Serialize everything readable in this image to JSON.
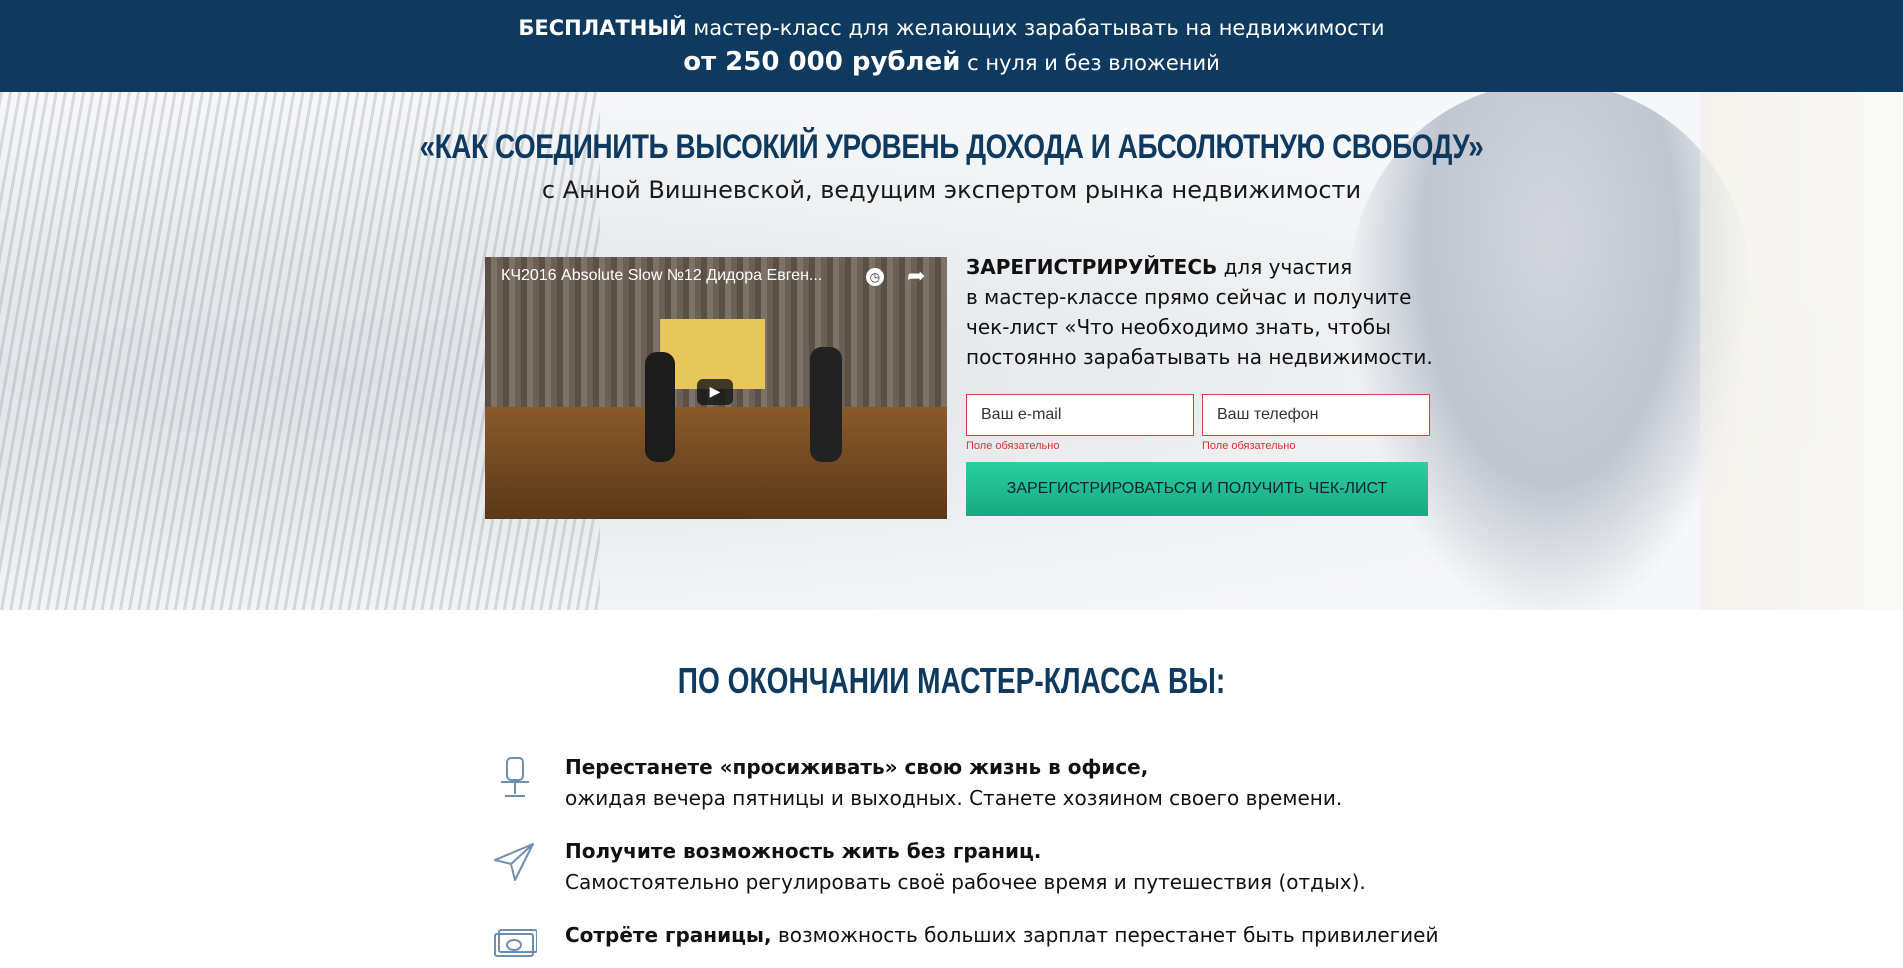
{
  "topbar": {
    "line1_bold": "БЕСПЛАТНЫЙ",
    "line1_rest": " мастер-класс для желающих зарабатывать на недвижимости",
    "line2_bold": "от 250 000 рублей",
    "line2_rest": " с нуля и без вложений"
  },
  "hero": {
    "title": "«КАК СОЕДИНИТЬ ВЫСОКИЙ УРОВЕНЬ ДОХОДА И АБСОЛЮТНУЮ СВОБОДУ»",
    "subtitle": "с Анной Вишневской, ведущим экспертом рынка недвижимости"
  },
  "video": {
    "title": "КЧ2016 Absolute Slow №12 Дидора Евген...",
    "clock_icon": "clock-icon",
    "share_icon": "share-icon",
    "play_icon": "play-icon"
  },
  "registration": {
    "lead_bold": "ЗАРЕГИСТРИРУЙТЕСЬ",
    "lead_rest": " для участия",
    "line2": "в мастер-классе прямо сейчас и получите",
    "line3": "чек-лист «Что необходимо знать, чтобы",
    "line4": "постоянно зарабатывать на недвижимости.",
    "email_placeholder": "Ваш e-mail",
    "phone_placeholder": "Ваш телефон",
    "email_error": "Поле обязательно",
    "phone_error": "Поле обязательно",
    "submit_label": "ЗАРЕГИСТРИРОВАТЬСЯ И ПОЛУЧИТЬ ЧЕК-ЛИСТ",
    "error_color": "#e23b3b",
    "button_color": "#1fbf8f"
  },
  "benefits": {
    "title": "ПО ОКОНЧАНИИ МАСТЕР-КЛАССА ВЫ:",
    "items": [
      {
        "icon": "office-chair-icon",
        "bold": "Перестанете «просиживать» свою жизнь в офисе,",
        "rest": "",
        "line2": "ожидая вечера пятницы и выходных. Станете хозяином своего времени."
      },
      {
        "icon": "paper-plane-icon",
        "bold": "Получите возможность жить без границ.",
        "rest": "",
        "line2": "Самостоятельно регулировать своё рабочее время и путешествия (отдых)."
      },
      {
        "icon": "money-icon",
        "bold": "Сотрёте границы,",
        "rest": " возможность больших зарплат перестанет быть привилегией",
        "line2": ""
      }
    ]
  },
  "colors": {
    "navy": "#0f3a5f"
  }
}
